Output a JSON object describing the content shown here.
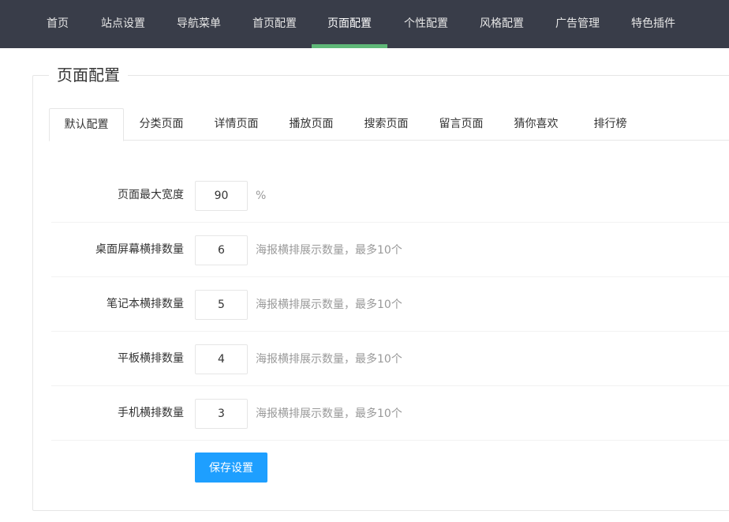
{
  "nav": {
    "items": [
      {
        "label": "首页"
      },
      {
        "label": "站点设置"
      },
      {
        "label": "导航菜单"
      },
      {
        "label": "首页配置"
      },
      {
        "label": "页面配置"
      },
      {
        "label": "个性配置"
      },
      {
        "label": "风格配置"
      },
      {
        "label": "广告管理"
      },
      {
        "label": "特色插件"
      }
    ],
    "active_index": 4,
    "indicator_color": "#5fb878",
    "background_color": "#393d49"
  },
  "panel": {
    "title": "页面配置"
  },
  "tabs": {
    "items": [
      {
        "label": "默认配置"
      },
      {
        "label": "分类页面"
      },
      {
        "label": "详情页面"
      },
      {
        "label": "播放页面"
      },
      {
        "label": "搜索页面"
      },
      {
        "label": "留言页面"
      },
      {
        "label": "猜你喜欢"
      },
      {
        "label": "排行榜"
      }
    ],
    "active_index": 0
  },
  "form": {
    "rows": [
      {
        "label": "页面最大宽度",
        "value": "90",
        "hint": "%"
      },
      {
        "label": "桌面屏幕横排数量",
        "value": "6",
        "hint": "海报横排展示数量，最多10个"
      },
      {
        "label": "笔记本横排数量",
        "value": "5",
        "hint": "海报横排展示数量，最多10个"
      },
      {
        "label": "平板横排数量",
        "value": "4",
        "hint": "海报横排展示数量，最多10个"
      },
      {
        "label": "手机横排数量",
        "value": "3",
        "hint": "海报横排展示数量，最多10个"
      }
    ],
    "save_label": "保存设置",
    "save_color": "#1e9fff"
  }
}
